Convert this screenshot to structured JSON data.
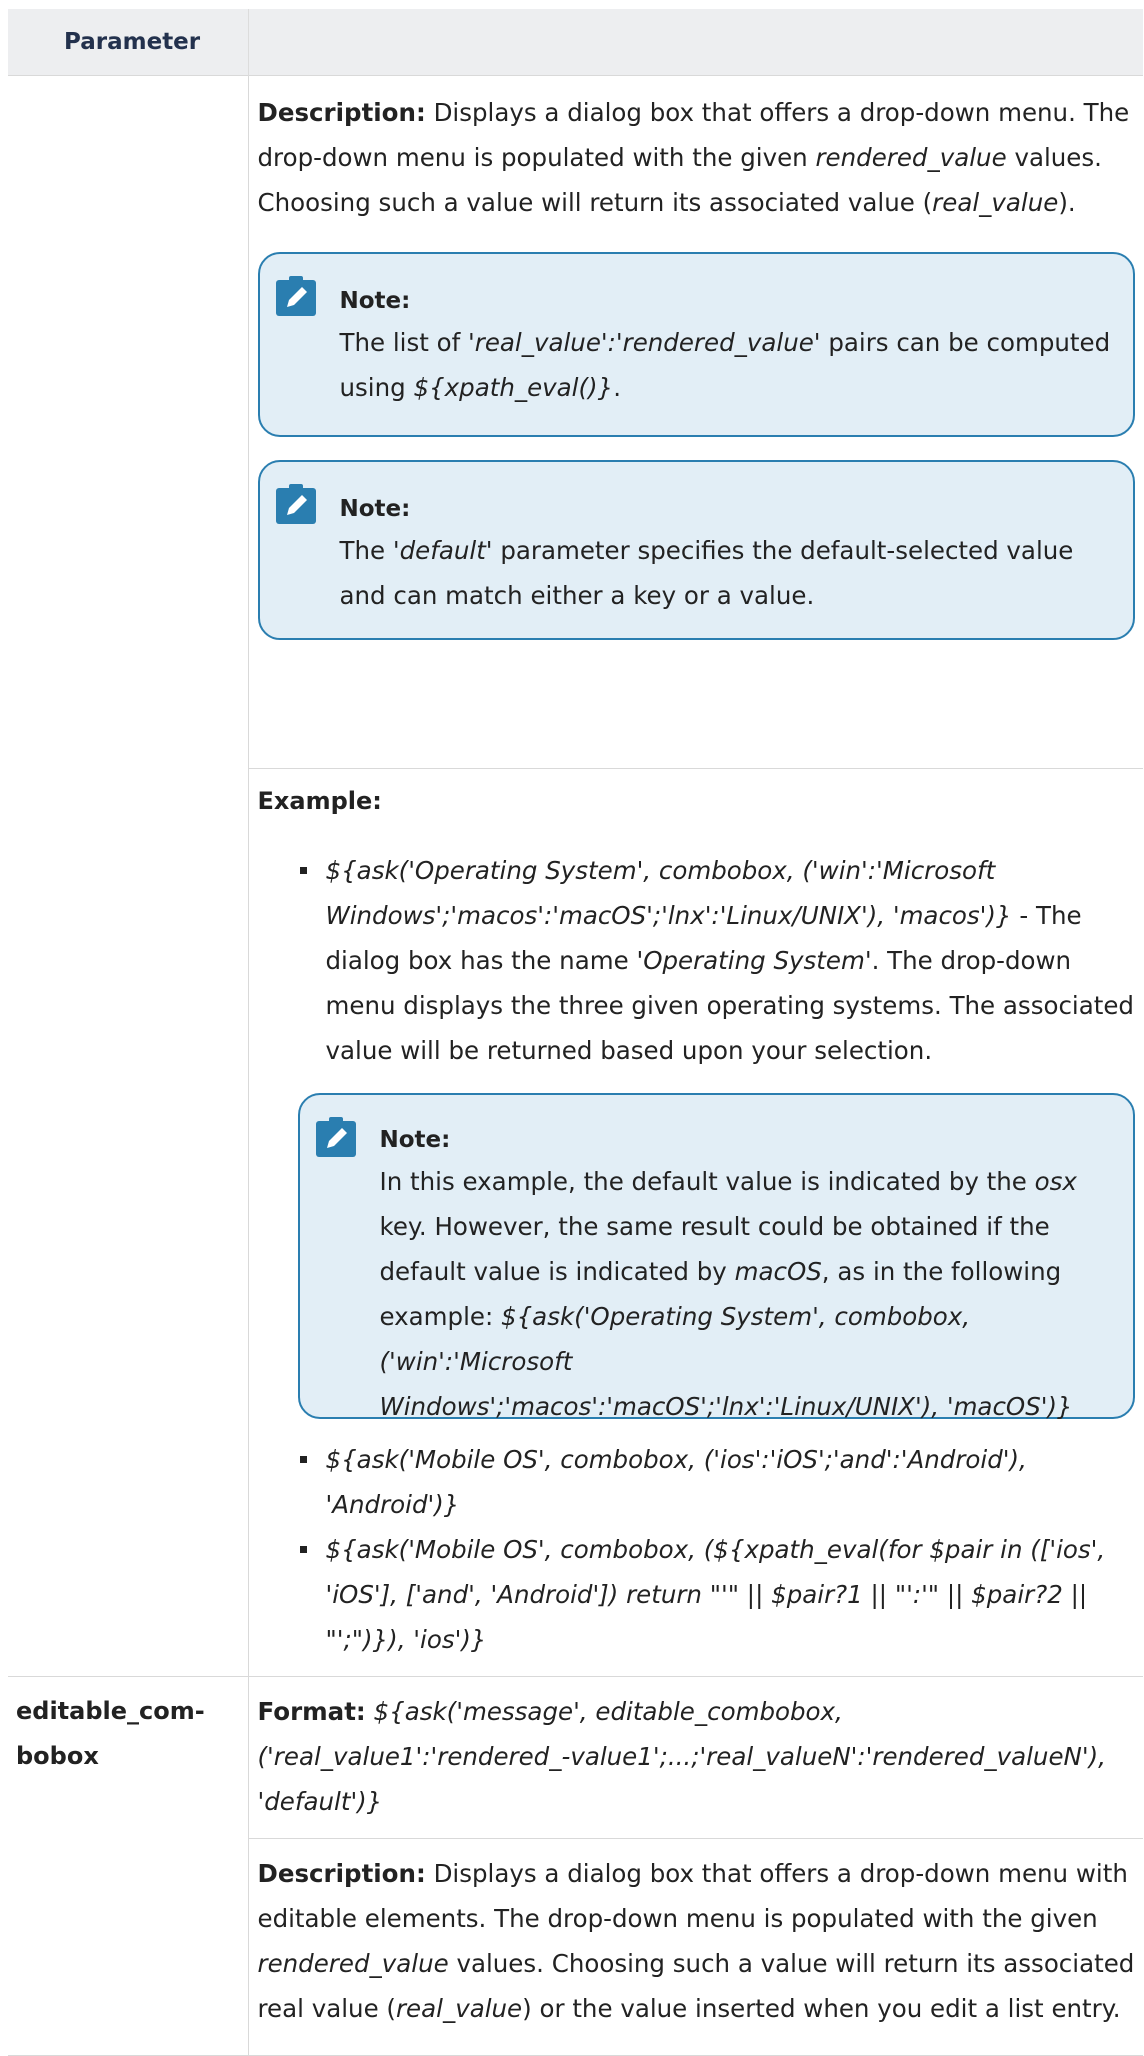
{
  "table": {
    "header": "Parameter"
  },
  "combobox_row": {
    "description_label": "Description:",
    "description_parts": [
      "Displays a dialog box that offers a drop-down menu. The drop-down menu is populated with the given ",
      "rendered_value",
      " values. Choosing such a value will return its associated value (",
      "real_value",
      ")."
    ],
    "note1": {
      "title": "Note:",
      "parts": [
        "The list of ",
        "'real_value':'rendered_value'",
        " pairs can be computed using ",
        "${xpath_eval()}",
        "."
      ]
    },
    "note2": {
      "title": "Note:",
      "parts": [
        "The ",
        "'default'",
        " parameter specifies the default-selected value and can match either a key or a value."
      ]
    },
    "example_label": "Example:",
    "example1": {
      "code": "${ask('Operating System', combobox, ('win':'Microsoft Windows';'macos':'macOS';'lnx':'Linux/UNIX'), 'macos')}",
      "text1": " - The dialog box has the name ",
      "name": "'Operating System'",
      "text2": ". The drop-down menu displays the three given operating systems. The associated value will be returned based upon your selection."
    },
    "note3": {
      "title": "Note:",
      "parts": [
        "In this example, the default value is indicated by the ",
        "osx",
        " key. However, the same result could be obtained if the default value is indicated by ",
        "macOS",
        ", as in the following example: ",
        "${ask('Operating System', combobox, ('win':'Microsoft Windows';'macos':'macOS';'lnx':'Linux/UNIX'), 'macOS')}"
      ]
    },
    "example2": "${ask('Mobile OS', combobox, ('ios':'iOS';'and':'Android'), 'Android')}",
    "example3": "${ask('Mobile OS', combobox, (${xpath_eval(for $pair in (['ios', 'iOS'], ['and', 'Android']) return \"'\" || $pair?1 || \"':'\" || $pair?2 || \"';\")}), 'ios')}"
  },
  "editable_row": {
    "parameter": "editable_com-bobox",
    "format_label": "Format:",
    "format_code": "${ask('message', editable_combobox, ('real_value1':'rendered_-value1';...;'real_valueN':'rendered_valueN'), 'default')}",
    "description_label": "Description:",
    "description_parts": [
      "Displays a dialog box that offers a drop-down menu with editable elements. The drop-down menu is populated with the given ",
      "rendered_value",
      " values. Choosing such a value will return its associated real value (",
      "real_value",
      ") or the value inserted when you edit a list entry."
    ]
  },
  "icons": {
    "note": "pencil-note-icon"
  },
  "colors": {
    "note_bg": "#e2eef6",
    "note_border": "#2a7eb0",
    "icon": "#2a7eb0",
    "header_text": "#23314d"
  }
}
